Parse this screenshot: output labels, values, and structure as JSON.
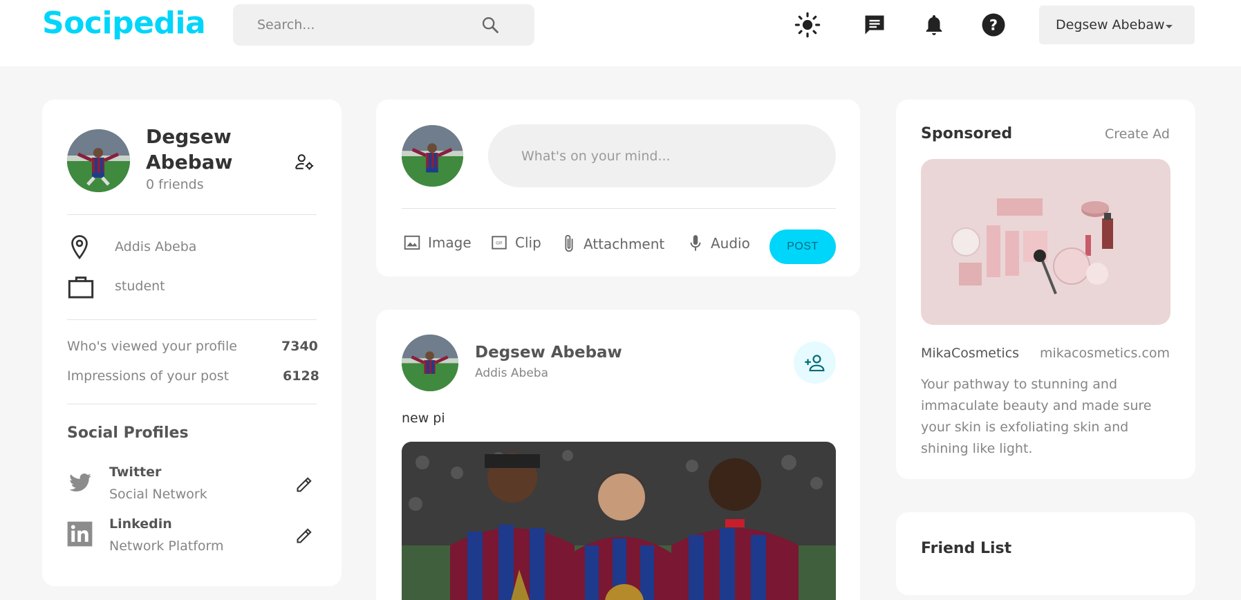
{
  "brand": {
    "name": "Socipedia",
    "color": "#00d5fa"
  },
  "navbar": {
    "search_placeholder": "Search...",
    "icons": [
      "sun-icon",
      "message-icon",
      "bell-icon",
      "help-icon"
    ],
    "user_name": "Degsew Abebaw"
  },
  "profile": {
    "name": "Degsew Abebaw",
    "friends": "0 friends",
    "location": "Addis Abeba",
    "occupation": "student",
    "viewed_label": "Who's viewed your profile",
    "viewed_value": "7340",
    "impressions_label": "Impressions of your post",
    "impressions_value": "6128",
    "social_title": "Social Profiles",
    "social": [
      {
        "name": "Twitter",
        "type": "Social Network"
      },
      {
        "name": "Linkedin",
        "type": "Network Platform"
      }
    ]
  },
  "composer": {
    "placeholder": "What's on your mind...",
    "tools": [
      "Image",
      "Clip",
      "Attachment",
      "Audio"
    ],
    "post_label": "POST"
  },
  "feed": {
    "post": {
      "author": "Degsew Abebaw",
      "location": "Addis Abeba",
      "text": "new pi"
    }
  },
  "sponsored": {
    "title": "Sponsored",
    "create_ad": "Create Ad",
    "brand": "MikaCosmetics",
    "site": "mikacosmetics.com",
    "description": "Your pathway to stunning and immaculate beauty and made sure your skin is exfoliating skin and shining like light."
  },
  "friend_list": {
    "title": "Friend List"
  }
}
